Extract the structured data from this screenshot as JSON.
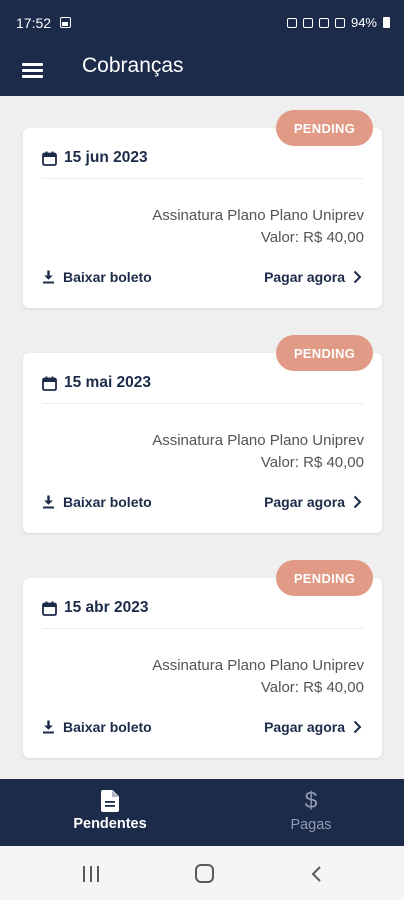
{
  "status_bar": {
    "time": "17:52",
    "battery": "94%"
  },
  "app_bar": {
    "title": "Cobranças",
    "menu_icon": "menu-icon"
  },
  "charges": [
    {
      "status": "PENDING",
      "date": "15 jun 2023",
      "description": "Assinatura Plano Plano Uniprev",
      "value": "Valor: R$ 40,00",
      "download_label": "Baixar boleto",
      "pay_label": "Pagar agora"
    },
    {
      "status": "PENDING",
      "date": "15 mai 2023",
      "description": "Assinatura Plano Plano Uniprev",
      "value": "Valor: R$ 40,00",
      "download_label": "Baixar boleto",
      "pay_label": "Pagar agora"
    },
    {
      "status": "PENDING",
      "date": "15 abr 2023",
      "description": "Assinatura Plano Plano Uniprev",
      "value": "Valor: R$ 40,00",
      "download_label": "Baixar boleto",
      "pay_label": "Pagar agora"
    }
  ],
  "bottom_nav": {
    "items": [
      {
        "label": "Pendentes",
        "icon": "document-icon",
        "active": true
      },
      {
        "label": "Pagas",
        "icon": "dollar-icon",
        "active": false
      }
    ]
  },
  "colors": {
    "primary": "#1c2b4a",
    "badge": "#e09a85",
    "background": "#efefef",
    "card": "#ffffff",
    "muted_text": "#545454",
    "inactive_nav": "#8f9ab0"
  }
}
